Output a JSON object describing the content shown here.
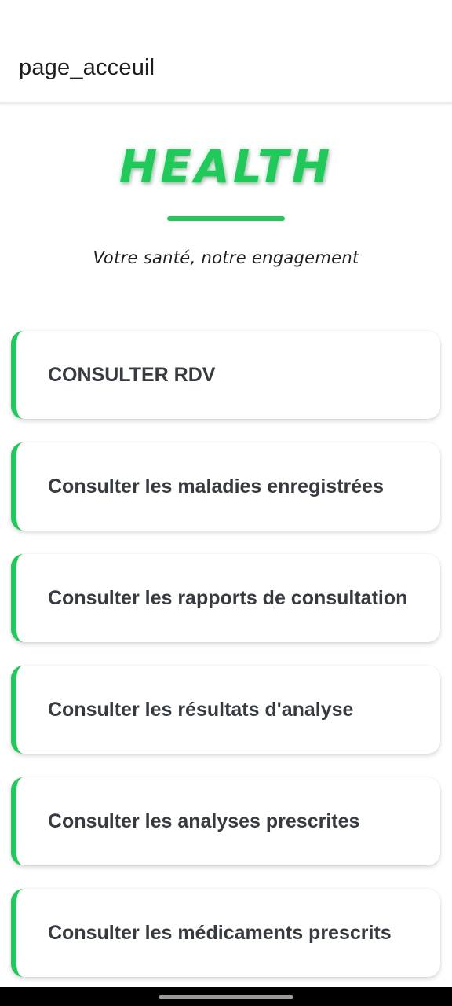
{
  "app_bar": {
    "title": "page_acceuil"
  },
  "brand": {
    "name": "HEALTH",
    "tagline": "Votre santé, notre engagement"
  },
  "menu": {
    "items": [
      {
        "label": "CONSULTER RDV"
      },
      {
        "label": "Consulter les maladies enregistrées"
      },
      {
        "label": "Consulter les rapports de consultation"
      },
      {
        "label": "Consulter les résultats d'analyse"
      },
      {
        "label": "Consulter les analyses prescrites"
      },
      {
        "label": "Consulter les médicaments prescrits"
      }
    ]
  },
  "colors": {
    "accent": "#21c85a",
    "text": "#353b41",
    "background": "#ffffff"
  }
}
